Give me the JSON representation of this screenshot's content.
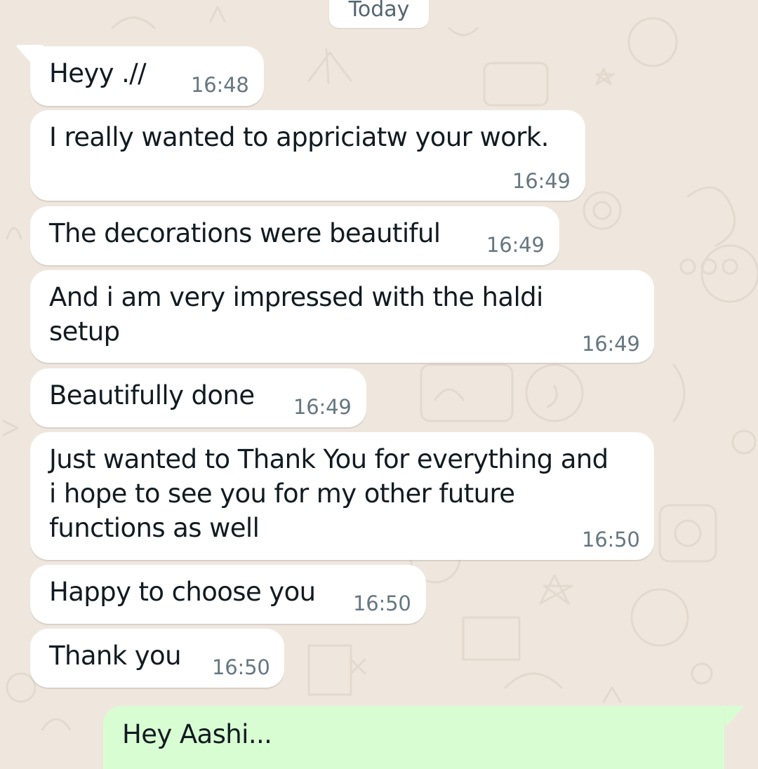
{
  "chat": {
    "date_label": "Today",
    "incoming": [
      {
        "text": "Heyy .//",
        "time": "16:48"
      },
      {
        "text": "I really wanted to appriciatw your work.",
        "time": "16:49"
      },
      {
        "text": "The decorations were beautiful",
        "time": "16:49"
      },
      {
        "text": "And i am very impressed with the haldi\nsetup",
        "time": "16:49"
      },
      {
        "text": "Beautifully done",
        "time": "16:49"
      },
      {
        "text": "Just wanted to Thank You for everything and\ni hope to see you for my other future\nfunctions as well",
        "time": "16:50"
      },
      {
        "text": "Happy to choose you",
        "time": "16:50"
      },
      {
        "text": "Thank you",
        "time": "16:50"
      }
    ],
    "outgoing": [
      {
        "text": "Hey Aashi..."
      }
    ]
  },
  "colors": {
    "wallpaper": "#efe7de",
    "incoming_bubble": "#ffffff",
    "outgoing_bubble": "#d9fdd3",
    "message_text": "#111b21",
    "timestamp": "#667781"
  }
}
